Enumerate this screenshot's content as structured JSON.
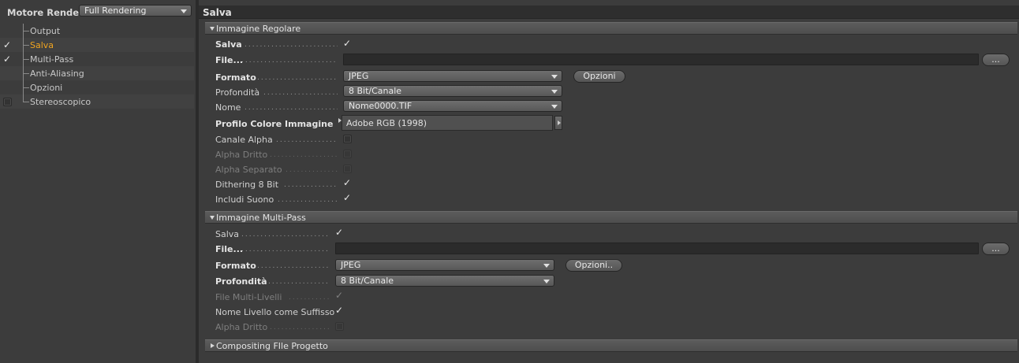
{
  "left_panel": {
    "engine_label": "Motore Render",
    "engine_value": "Full Rendering",
    "tree": [
      {
        "label": "Output",
        "checked": false,
        "has_checkbox": false,
        "active": false
      },
      {
        "label": "Salva",
        "checked": true,
        "has_checkbox": true,
        "active": true
      },
      {
        "label": "Multi-Pass",
        "checked": true,
        "has_checkbox": true,
        "active": false
      },
      {
        "label": "Anti-Aliasing",
        "checked": false,
        "has_checkbox": false,
        "active": false
      },
      {
        "label": "Opzioni",
        "checked": false,
        "has_checkbox": false,
        "active": false
      },
      {
        "label": "Stereoscopico",
        "checked": false,
        "has_checkbox": true,
        "active": false
      }
    ]
  },
  "right_panel": {
    "title": "Salva",
    "regular": {
      "section_label": "Immagine Regolare",
      "save_label": "Salva",
      "save_checked": true,
      "file_label": "File...",
      "file_value": "",
      "browse_label": "...",
      "format_label": "Formato",
      "format_value": "JPEG",
      "options_label": "Opzioni",
      "depth_label": "Profondità",
      "depth_value": "8 Bit/Canale",
      "name_label": "Nome",
      "name_value": "Nome0000.TIF",
      "profile_label": "Profilo Colore Immagine",
      "profile_value": "Adobe RGB (1998)",
      "alpha_channel_label": "Canale Alpha",
      "alpha_channel_checked": false,
      "straight_alpha_label": "Alpha Dritto",
      "straight_alpha_checked": false,
      "separate_alpha_label": "Alpha Separato",
      "separate_alpha_checked": false,
      "dithering_label": "Dithering 8 Bit",
      "dithering_checked": true,
      "sound_label": "Includi Suono",
      "sound_checked": true
    },
    "multipass": {
      "section_label": "Immagine Multi-Pass",
      "save_label": "Salva",
      "save_checked": true,
      "file_label": "File...",
      "file_value": "",
      "browse_label": "...",
      "format_label": "Formato",
      "format_value": "JPEG",
      "options_label": "Opzioni..",
      "depth_label": "Profondità",
      "depth_value": "8 Bit/Canale",
      "multilayer_label": "File Multi-Livelli",
      "multilayer_checked": true,
      "layer_suffix_label": "Nome Livello come Suffisso",
      "layer_suffix_checked": true,
      "straight_alpha_label": "Alpha Dritto",
      "straight_alpha_checked": false
    },
    "compositing": {
      "section_label": "Compositing FIle Progetto"
    }
  },
  "colors": {
    "active_item": "#f0a420",
    "panel_bg": "#3c3c3c",
    "field_bg": "#2b2b2b"
  }
}
